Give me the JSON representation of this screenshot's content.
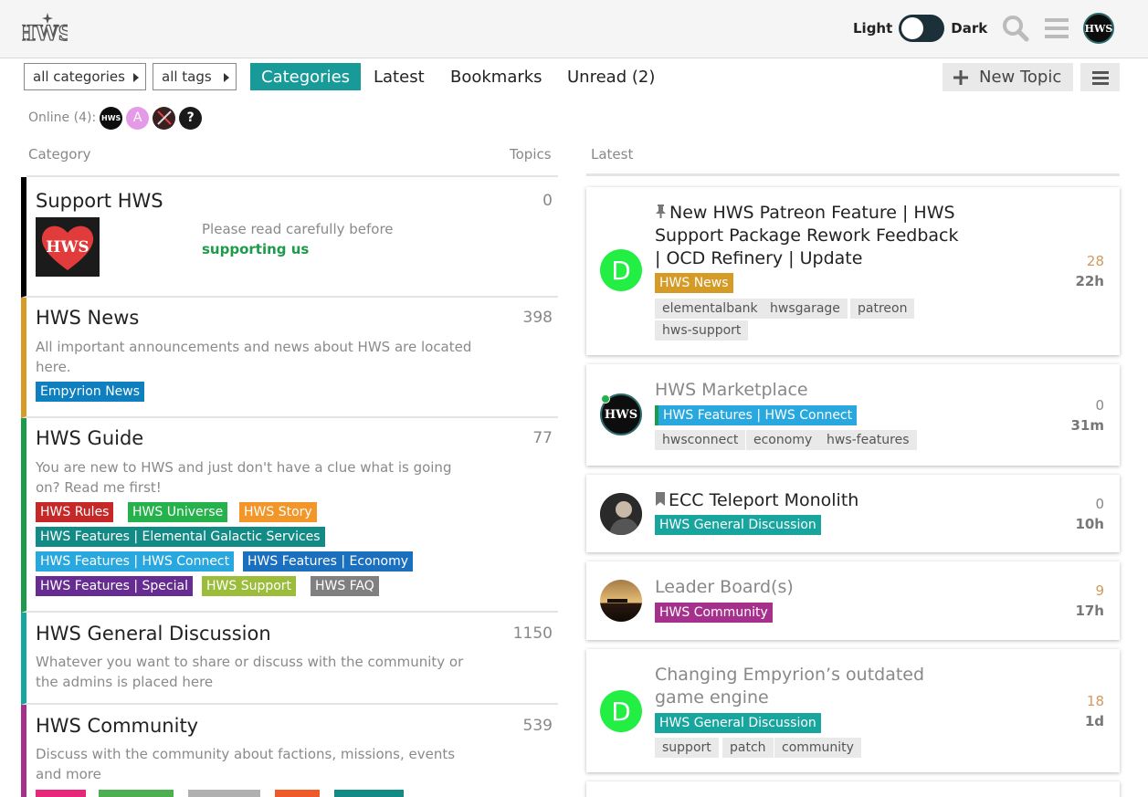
{
  "header": {
    "logo_text": "HWS",
    "theme_light": "Light",
    "theme_dark": "Dark",
    "icons": [
      "search-icon",
      "hamburger-icon"
    ],
    "avatar_text": "HWS"
  },
  "nav": {
    "categories_filter": "all categories",
    "tags_filter": "all tags",
    "tabs": [
      "Categories",
      "Latest",
      "Bookmarks",
      "Unread (2)"
    ],
    "active_tab": "Categories",
    "new_topic": "New Topic"
  },
  "online": {
    "label": "Online (4):",
    "users": [
      "HWS",
      "A",
      "",
      "?"
    ]
  },
  "columns": {
    "category": "Category",
    "topics": "Topics",
    "latest": "Latest"
  },
  "categories": [
    {
      "name": "Support HWS",
      "count": "0",
      "color": "#0e1f2f",
      "desc": "Please read carefully before ",
      "desc_link": "supporting us",
      "logo_text": "HWS"
    },
    {
      "name": "HWS News",
      "count": "398",
      "color": "#d59b26",
      "desc": "All important announcements and news about HWS are located here.",
      "subcategories": [
        {
          "name": "Empyrion News",
          "color": "#0e7fbf"
        }
      ]
    },
    {
      "name": "HWS Guide",
      "count": "77",
      "color": "#1c9b4a",
      "desc": "You are new to HWS and just don't have a clue what is going on? Read me first!",
      "subcategories": [
        {
          "name": "HWS Rules",
          "color": "#c62828"
        },
        {
          "name": "HWS Universe",
          "color": "#25b24c"
        },
        {
          "name": "HWS Story",
          "color": "#f2962a"
        },
        {
          "name": "HWS Features | Elemental Galactic Services",
          "color": "#128a85"
        },
        {
          "name": "HWS Features | HWS Connect",
          "color": "#29a8e0"
        },
        {
          "name": "HWS Features | Economy",
          "color": "#1a6fbf"
        },
        {
          "name": "HWS Features | Special",
          "color": "#662c91"
        },
        {
          "name": "HWS Support",
          "color": "#9cbc3c"
        },
        {
          "name": "HWS FAQ",
          "color": "#808080"
        }
      ]
    },
    {
      "name": "HWS General Discussion",
      "count": "1150",
      "color": "#17a59e",
      "desc": "Whatever you want to share or discuss with the community or the admins is placed here"
    },
    {
      "name": "HWS Community",
      "count": "539",
      "color": "#a6318c",
      "desc": "Discuss with the community about factions, missions, events and more",
      "subcategory_colors": [
        "#e8267a",
        "#4caf50",
        "#b0b0b0",
        "#f05a28",
        "#128a85"
      ]
    }
  ],
  "topics": [
    {
      "title": "New HWS Patreon Feature | HWS Support Package Rework Feedback | OCD Refinery | Update",
      "pinned": true,
      "read": false,
      "category": "HWS News",
      "category_color": "#d59b26",
      "tags": [
        "elementalbank",
        "hwsgarage",
        "patreon",
        "hws-support"
      ],
      "posts": "28",
      "posts_color": "#d19a5c",
      "age": "22h",
      "avatar": "D"
    },
    {
      "title": "HWS Marketplace",
      "pinned": false,
      "read": true,
      "category": "HWS Features | HWS Connect",
      "category_color": "#29a8e0",
      "tags": [
        "hwsconnect",
        "economy",
        "hws-features"
      ],
      "posts": "0",
      "posts_color": "#888888",
      "age": "31m",
      "avatar": "HWS"
    },
    {
      "title": "ECC Teleport Monolith",
      "pinned": false,
      "bookmarked": true,
      "read": false,
      "category": "HWS General Discussion",
      "category_color": "#17a59e",
      "tags": [],
      "posts": "0",
      "posts_color": "#888888",
      "age": "10h",
      "avatar": ""
    },
    {
      "title": "Leader Board(s)",
      "pinned": false,
      "read": true,
      "category": "HWS Community",
      "category_color": "#a6318c",
      "tags": [],
      "posts": "9",
      "posts_color": "#d19a5c",
      "age": "17h",
      "avatar": ""
    },
    {
      "title": "Changing Empyrion’s outdated game engine",
      "pinned": false,
      "read": true,
      "category": "HWS General Discussion",
      "category_color": "#17a59e",
      "tags": [
        "support",
        "patch",
        "community"
      ],
      "posts": "18",
      "posts_color": "#d19a5c",
      "age": "1d",
      "avatar": "D"
    }
  ]
}
